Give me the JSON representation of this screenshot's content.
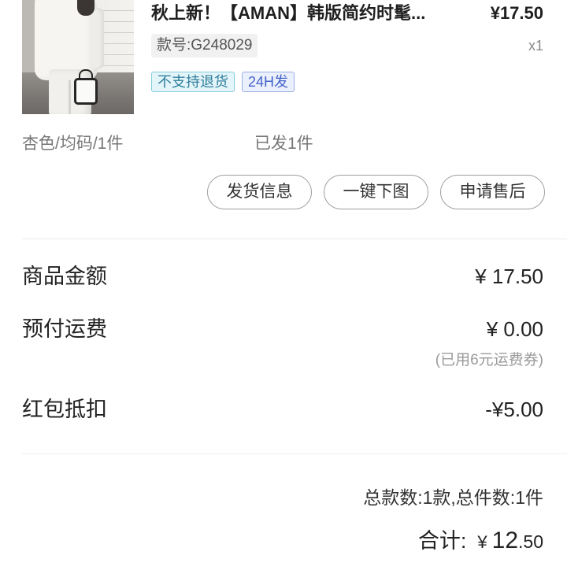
{
  "product": {
    "title": "秋上新！【AMAN】韩版简约时髦...",
    "price": "¥17.50",
    "style_no": "款号:G248029",
    "quantity": "x1",
    "tags": [
      {
        "label": "不支持退货",
        "text_color": "#2f7f9c",
        "bg_color": "#e4f5fa",
        "border_color": "#86cde0"
      },
      {
        "label": "24H发",
        "text_color": "#4563c9",
        "bg_color": "#ebf0fd",
        "border_color": "#9aaeea"
      }
    ],
    "spec": "杏色/均码/1件",
    "shipped_status": "已发1件"
  },
  "actions": [
    {
      "label": "发货信息"
    },
    {
      "label": "一键下图"
    },
    {
      "label": "申请售后"
    }
  ],
  "summary": {
    "goods_amount": {
      "label": "商品金额",
      "value": "¥ 17.50"
    },
    "shipping_fee": {
      "label": "预付运费",
      "value": "¥ 0.00",
      "note": "(已用6元运费券)"
    },
    "red_packet": {
      "label": "红包抵扣",
      "value": "-¥5.00"
    }
  },
  "totals": {
    "count_text": "总款数:1款,总件数:1件",
    "total_label": "合计:",
    "currency": "¥",
    "amount_integer": "12",
    "amount_decimal": ".50"
  }
}
